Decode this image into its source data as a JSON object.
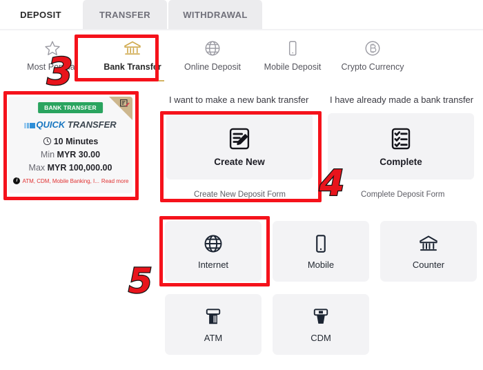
{
  "tabs": [
    {
      "label": "DEPOSIT",
      "active": true,
      "name": "tab-deposit"
    },
    {
      "label": "TRANSFER",
      "active": false,
      "name": "tab-transfer"
    },
    {
      "label": "WITHDRAWAL",
      "active": false,
      "name": "tab-withdrawal"
    }
  ],
  "methods": [
    {
      "label": "Most Popular",
      "icon": "star-icon",
      "selected": false
    },
    {
      "label": "Bank Transfer",
      "icon": "bank-icon",
      "selected": true
    },
    {
      "label": "Online Deposit",
      "icon": "globe-icon",
      "selected": false
    },
    {
      "label": "Mobile Deposit",
      "icon": "mobile-phone-icon",
      "selected": false
    },
    {
      "label": "Crypto Currency",
      "icon": "bitcoin-circle-icon",
      "selected": false
    }
  ],
  "promo_card": {
    "badge": "BANK TRANSFER",
    "logo_part1": "QUICK",
    "logo_part2": "TRANSFER",
    "duration": "10 Minutes",
    "min_label": "Min",
    "min_value": "MYR 30.00",
    "max_label": "Max",
    "max_value": "MYR 100,000.00",
    "note": "ATM, CDM, Mobile Banking, I...",
    "read_more": "Read more",
    "corner_icon": "promo-tag-icon",
    "clock_icon": "clock-icon",
    "info_icon": "info-icon"
  },
  "sections": {
    "new_transfer_heading": "I want to make a new bank transfer",
    "made_transfer_heading": "I have already made a bank transfer"
  },
  "action_boxes": [
    {
      "label": "Create New",
      "caption": "Create New Deposit Form",
      "icon": "form-edit-icon",
      "name": "create-new-box"
    },
    {
      "label": "Complete",
      "caption": "Complete Deposit Form",
      "icon": "checklist-icon",
      "name": "complete-box"
    }
  ],
  "channels": [
    {
      "label": "Internet",
      "icon": "globe-icon",
      "selected": true
    },
    {
      "label": "Mobile",
      "icon": "mobile-phone-icon",
      "selected": false
    },
    {
      "label": "Counter",
      "icon": "bank-icon",
      "selected": false
    },
    {
      "label": "ATM",
      "icon": "atm-icon",
      "selected": false
    },
    {
      "label": "CDM",
      "icon": "cdm-icon",
      "selected": false
    }
  ],
  "annotations": [
    {
      "number": "3",
      "target": "Bank Transfer method tile"
    },
    {
      "number": "4",
      "target": "Create New deposit form box"
    },
    {
      "number": "5",
      "target": "Internet channel tile"
    }
  ],
  "colors": {
    "annotation_red": "#f5121b",
    "badge_green": "#2aa45f",
    "selected_gold": "#d3b362",
    "note_red": "#e03131",
    "card_grey": "#f3f3f5"
  }
}
